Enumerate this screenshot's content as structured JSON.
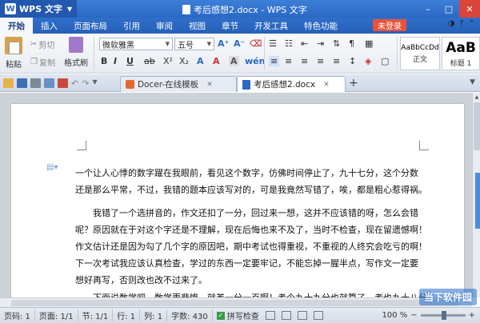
{
  "titlebar": {
    "app_name": "WPS 文字",
    "window_title": "考后感想2.docx - WPS 文字",
    "minimize": "–",
    "maximize": "□",
    "close": "✕"
  },
  "menubar": {
    "items": [
      "开始",
      "插入",
      "页面布局",
      "引用",
      "审阅",
      "视图",
      "章节",
      "开发工具",
      "特色功能"
    ],
    "login": "未登录"
  },
  "ribbon": {
    "paste": "粘贴",
    "cut": "剪切",
    "copy": "复制",
    "format_painter": "格式刷",
    "font_name": "微软雅黑",
    "font_size": "五号",
    "bold": "B",
    "italic": "I",
    "underline": "U",
    "styles": [
      {
        "sample": "AaBbCcDd",
        "name": "正文"
      },
      {
        "sample": "AaB",
        "name": "标题 1"
      }
    ]
  },
  "tabs": [
    {
      "label": "Docer-在线模板",
      "active": false
    },
    {
      "label": "考后感想2.docx",
      "active": true
    }
  ],
  "document": {
    "paragraph1": [
      "一个让人心悸的数字躍在我眼前，看见这个数字，仿佛时间停止了，九十七分，这个分数",
      "还是那么平常，不过，我错的题本应该写对的，可是我竟然写错了，唉，都是粗心惹得祸。"
    ],
    "paragraph2": [
      "　　我错了一个选拼音的，作文还扣了一分，回过来一想，这并不应该错的呀，怎么会错",
      "呢？原因就在于对这个字还是不理解，现在后悔也来不及了，当时不检查，现在留遗憾啊！",
      "作文估计还是因为勾了几个字的原因吧，期中考试也得重视，不重视的人终究会吃亏的啊！",
      "下一次考试我应该认真检查，学过的东西一定要牢记，不能忘掉一腥半点，写作文一定要",
      "想好再写，否则改也改不过来了。"
    ],
    "paragraph3": [
      "　　下面说数学吧，数学更悲惨，就差一分一百啊！考个九十九分也就算了，考也九十八分"
    ]
  },
  "statusbar": {
    "page_num": "页码: 1",
    "page": "页面: 1/1",
    "section": "节: 1/1",
    "row": "行: 1",
    "col": "列: 1",
    "wordcount": "字数: 430",
    "spellcheck": "拼写检查",
    "zoom": "100 %"
  },
  "watermark": "当下软件园"
}
